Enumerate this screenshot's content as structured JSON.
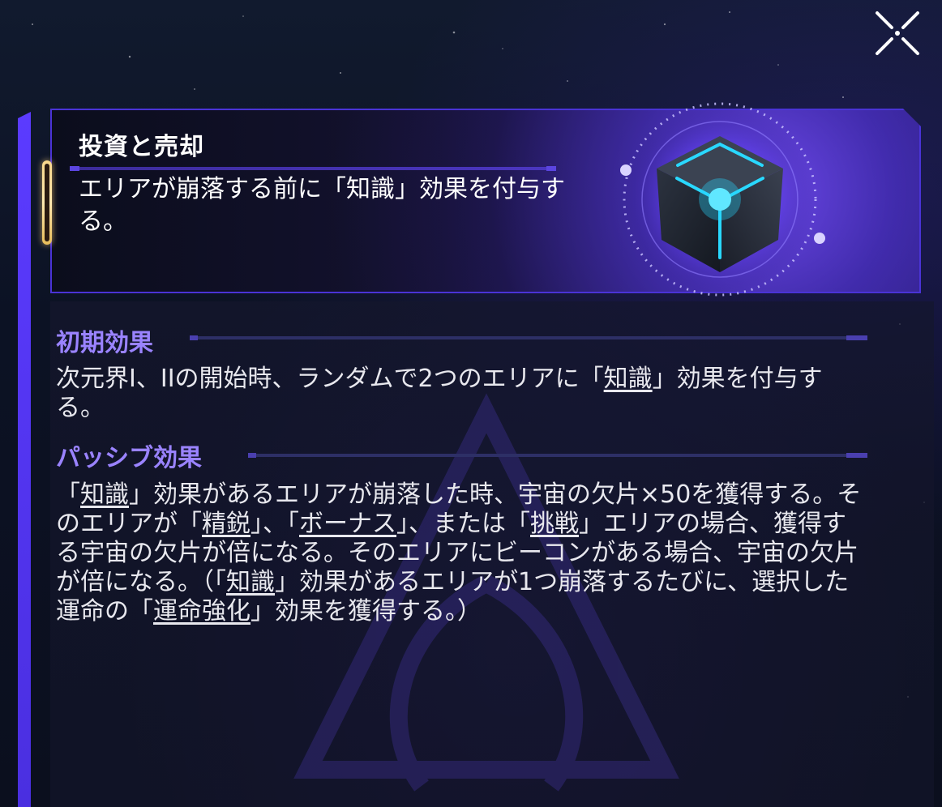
{
  "close_icon": "close-x-icon",
  "header": {
    "title": "投資と売却",
    "description": "エリアが崩落する前に「知識」効果を付与する。",
    "artifact_icon": "glowing-cube-icon",
    "accent_color": "#5b3bff"
  },
  "sections": [
    {
      "title": "初期効果",
      "text_parts": [
        "次元界I、IIの開始時、ランダムで2つのエリアに「",
        "知識",
        "」効果を付与する。"
      ]
    },
    {
      "title": "パッシブ効果",
      "text_parts": [
        "「",
        "知識",
        "」効果があるエリアが崩落した時、宇宙の欠片×50を獲得する。そのエリアが「",
        "精鋭",
        "」、「",
        "ボーナス",
        "」、または「",
        "挑戦",
        "」エリアの場合、獲得する宇宙の欠片が倍になる。そのエリアにビーコンがある場合、宇宙の欠片が倍になる。（「",
        "知識",
        "」効果があるエリアが1つ崩落するたびに、選択した運命の「",
        "運命強化",
        "」効果を獲得する。）"
      ]
    }
  ],
  "colors": {
    "section_title": "#9a83ff",
    "body_text": "#e8e8ee",
    "frame": "#4a33d6"
  }
}
